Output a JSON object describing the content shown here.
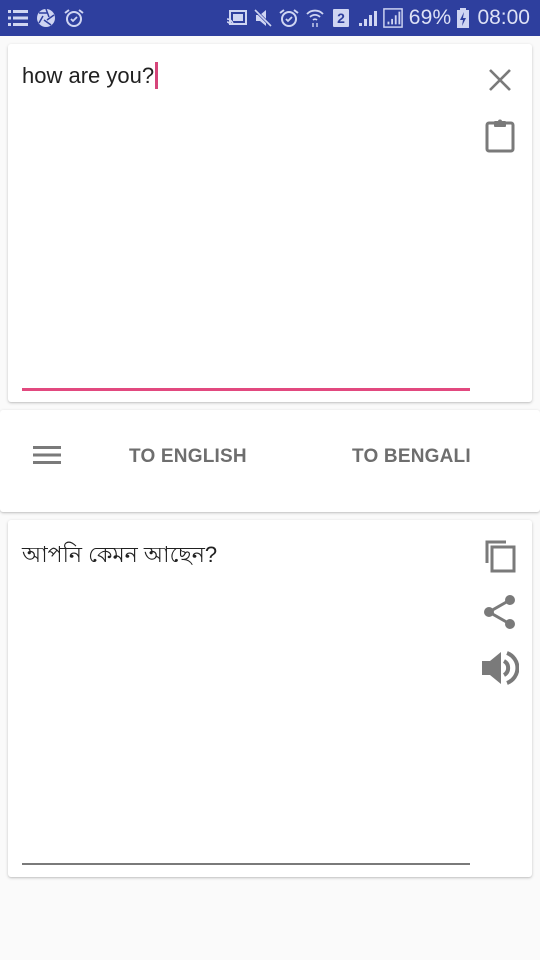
{
  "status_bar": {
    "left_icons": [
      "notification-list-icon",
      "aperture-icon",
      "alarm-icon"
    ],
    "right_icons": [
      "cast-icon",
      "mute-icon",
      "alarm-icon",
      "wifi-icon",
      "sim2-icon",
      "signal-icon",
      "signal-boxed-icon"
    ],
    "sim_label": "2",
    "battery_percent": "69%",
    "time": "08:00"
  },
  "input_card": {
    "text": "how are you?",
    "clear_icon": "close-icon",
    "paste_icon": "clipboard-icon",
    "accent_color": "#e2497f"
  },
  "tab_bar": {
    "menu_icon": "menu-icon",
    "tabs": [
      {
        "label": "TO ENGLISH"
      },
      {
        "label": "TO BENGALI"
      }
    ]
  },
  "output_card": {
    "text": "আপনি কেমন আছেন?",
    "actions": [
      {
        "icon": "copy-icon"
      },
      {
        "icon": "share-icon"
      },
      {
        "icon": "speaker-icon"
      }
    ]
  },
  "colors": {
    "status_bar": "#2e3f9e",
    "icon_gray": "#757575",
    "tab_text": "#6e6e6e"
  }
}
